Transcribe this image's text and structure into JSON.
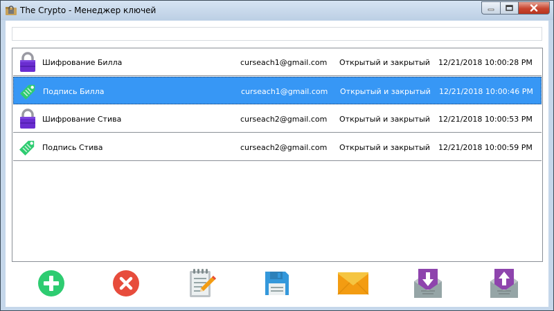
{
  "window": {
    "title": "The Crypto - Менеджер ключей",
    "app_icon": "folder-lock-icon"
  },
  "search": {
    "value": "",
    "placeholder": ""
  },
  "keys": [
    {
      "name": "Шифрование Билла",
      "email": "curseach1@gmail.com",
      "type": "Открытый и закрытый",
      "date": "12/21/2018 10:00:28 PM",
      "icon": "lock-icon",
      "selected": false
    },
    {
      "name": "Подпись Билла",
      "email": "curseach1@gmail.com",
      "type": "Открытый и закрытый",
      "date": "12/21/2018 10:00:46 PM",
      "icon": "tag-icon",
      "selected": true
    },
    {
      "name": "Шифрование Стива",
      "email": "curseach2@gmail.com",
      "type": "Открытый и закрытый",
      "date": "12/21/2018 10:00:53 PM",
      "icon": "lock-icon",
      "selected": false
    },
    {
      "name": "Подпись Стива",
      "email": "curseach2@gmail.com",
      "type": "Открытый и закрытый",
      "date": "12/21/2018 10:00:59 PM",
      "icon": "tag-icon",
      "selected": false
    }
  ],
  "toolbar": [
    {
      "icon": "add-icon",
      "color": "#2ecc71"
    },
    {
      "icon": "delete-icon",
      "color": "#e74c3c"
    },
    {
      "icon": "edit-notepad-icon",
      "color": "#f39c12"
    },
    {
      "icon": "save-floppy-icon",
      "color": "#3498db"
    },
    {
      "icon": "mail-envelope-icon",
      "color": "#f5b841"
    },
    {
      "icon": "import-key-icon",
      "color": "#8e44ad"
    },
    {
      "icon": "export-key-icon",
      "color": "#8e44ad"
    }
  ],
  "colors": {
    "selection": "#3797f5",
    "lock": "#6a2dd0",
    "tag": "#2ecc71"
  }
}
